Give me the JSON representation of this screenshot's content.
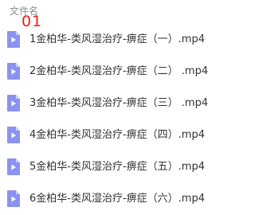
{
  "header": {
    "column_label": "文件名",
    "annotation": "01"
  },
  "files": [
    {
      "name": "1金柏华-类风湿治疗-痹症（一）.mp4",
      "icon": "video-file-icon"
    },
    {
      "name": "2金柏华-类风湿治疗-痹症（二） .mp4",
      "icon": "video-file-icon"
    },
    {
      "name": "3金柏华-类风湿治疗-痹症（三） .mp4",
      "icon": "video-file-icon"
    },
    {
      "name": "4金柏华-类风湿治疗-痹症（四）.mp4",
      "icon": "video-file-icon"
    },
    {
      "name": "5金柏华-类风湿治疗-痹症（五）.mp4",
      "icon": "video-file-icon"
    },
    {
      "name": "6金柏华-类风湿治疗-痹症（六）.mp4",
      "icon": "video-file-icon"
    }
  ],
  "colors": {
    "icon_body": "#8a93f0",
    "icon_fold": "#c9cdfa",
    "annotation": "#ee1c1c",
    "header_text": "#8c8c8c",
    "file_text": "#333333"
  }
}
